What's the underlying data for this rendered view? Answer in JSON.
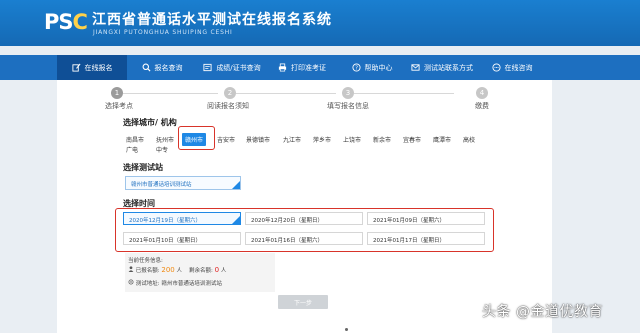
{
  "header": {
    "logo": "PSC",
    "title": "江西省普通话水平测试在线报名系统",
    "subtitle": "JIANGXI PUTONGHUA SHUIPING CESHI"
  },
  "nav": {
    "items": [
      {
        "label": "在线报名",
        "icon": "edit-icon",
        "active": true
      },
      {
        "label": "报名查询",
        "icon": "search-icon",
        "active": false
      },
      {
        "label": "成绩/证书查询",
        "icon": "certificate-icon",
        "active": false
      },
      {
        "label": "打印准考证",
        "icon": "printer-icon",
        "active": false
      },
      {
        "label": "帮助中心",
        "icon": "help-icon",
        "active": false
      },
      {
        "label": "测试站联系方式",
        "icon": "contact-icon",
        "active": false
      },
      {
        "label": "在线咨询",
        "icon": "chat-icon",
        "active": false
      }
    ]
  },
  "steps": [
    {
      "num": "1",
      "label": "选择考点"
    },
    {
      "num": "2",
      "label": "阅读报名须知"
    },
    {
      "num": "3",
      "label": "填写报名信息"
    },
    {
      "num": "4",
      "label": "缴费"
    }
  ],
  "city_section": {
    "title": "选择城市/ 机构",
    "cities": [
      "南昌市",
      "抚州市",
      "赣州市",
      "吉安市",
      "景德镇市",
      "九江市",
      "萍乡市",
      "上饶市",
      "新余市",
      "宜春市",
      "鹰潭市",
      "高校",
      "广电",
      "中专"
    ],
    "selected": "赣州市"
  },
  "station_section": {
    "title": "选择测试站",
    "selected_station": "赣州市普通话培训测试站"
  },
  "time_section": {
    "title": "选择时间",
    "times": [
      "2020年12月19日（星期六）",
      "2020年12月20日（星期日）",
      "2021年01月09日（星期六）",
      "2021年01月10日（星期日）",
      "2021年01月16日（星期六）",
      "2021年01月17日（星期日）"
    ],
    "selected": "2020年12月19日（星期六）"
  },
  "info": {
    "heading": "当前任务信息:",
    "registered_label": "已报名额:",
    "registered_value": "200",
    "registered_unit": "人",
    "remaining_label": "剩余名额:",
    "remaining_value": "0",
    "remaining_unit": "人",
    "address_label": "测试地址:",
    "address_value": "赣州市普通话培训测试站"
  },
  "next_button": "下一步",
  "watermark": "头条 @金道优教育",
  "colors": {
    "header_blue": "#1a7fd0",
    "nav_blue": "#1d6fc0",
    "nav_active": "#0f4f96",
    "accent_blue": "#1e88e5",
    "highlight_red": "#d8342a",
    "orange": "#f08a12",
    "red": "#e02020"
  }
}
